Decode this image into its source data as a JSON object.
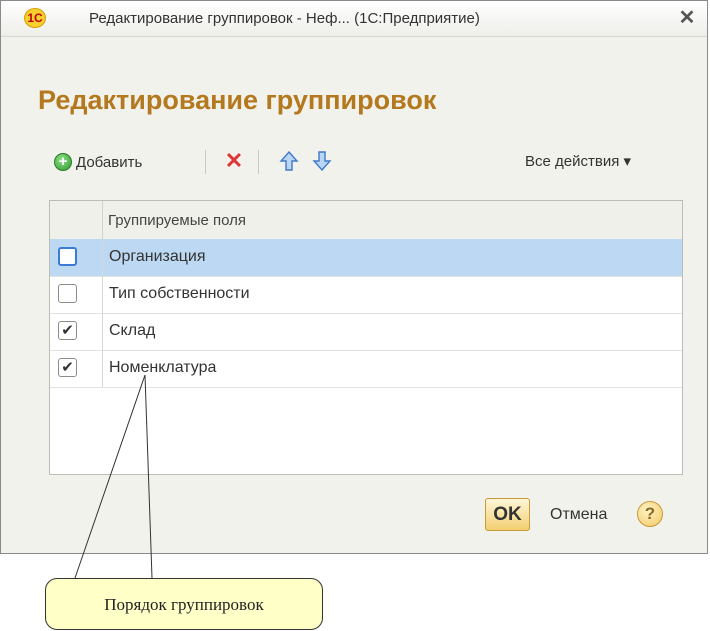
{
  "window": {
    "app_icon": "1C",
    "title": "Редактирование группировок - Неф... (1С:Предприятие)",
    "close": "✕"
  },
  "heading": "Редактирование группировок",
  "toolbar": {
    "add_label": "Добавить",
    "delete_icon": "delete-icon",
    "move_up_icon": "arrow-up-icon",
    "move_down_icon": "arrow-down-icon",
    "all_actions_label": "Все действия ▾"
  },
  "table": {
    "column_header": "Группируемые поля",
    "rows": [
      {
        "label": "Организация",
        "checked": false,
        "selected": true,
        "mark": ""
      },
      {
        "label": "Тип собственности",
        "checked": false,
        "selected": false,
        "mark": ""
      },
      {
        "label": "Склад",
        "checked": true,
        "selected": false,
        "mark": "✔"
      },
      {
        "label": "Номенклатура",
        "checked": true,
        "selected": false,
        "mark": "✔"
      }
    ]
  },
  "footer": {
    "ok_label": "OK",
    "cancel_label": "Отмена",
    "help_label": "?"
  },
  "callout": {
    "text": "Порядок группировок"
  },
  "colors": {
    "heading": "#b4781e",
    "selection": "#bcd8f2",
    "callout_fill": "#ffffc8"
  }
}
